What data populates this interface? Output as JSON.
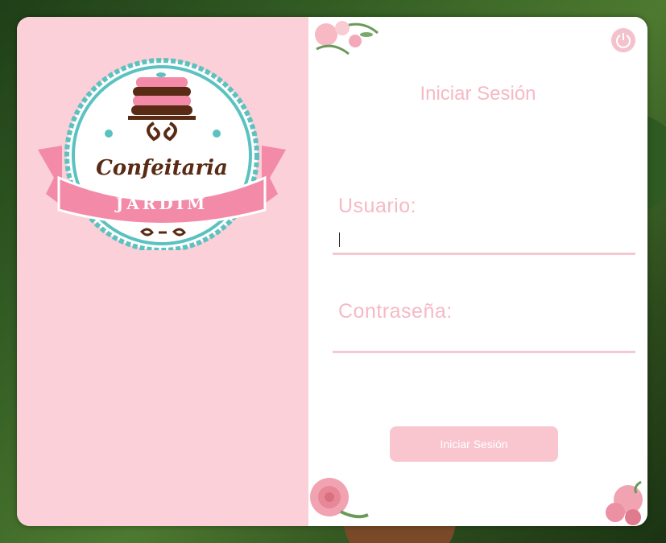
{
  "logo": {
    "brand_line1": "Confeitaria",
    "brand_line2": "JARDIM"
  },
  "login": {
    "title": "Iniciar Sesión",
    "user_label": "Usuario:",
    "user_value": "",
    "password_label": "Contraseña:",
    "password_value": "",
    "submit_label": "Iniciar Sesión"
  },
  "icons": {
    "power": "power-icon"
  },
  "colors": {
    "left_panel": "#fbd0d8",
    "accent_text": "#f6b9c6",
    "button_bg": "#f9c6d0",
    "teal": "#5cc2c0",
    "brown": "#5a2b14"
  }
}
